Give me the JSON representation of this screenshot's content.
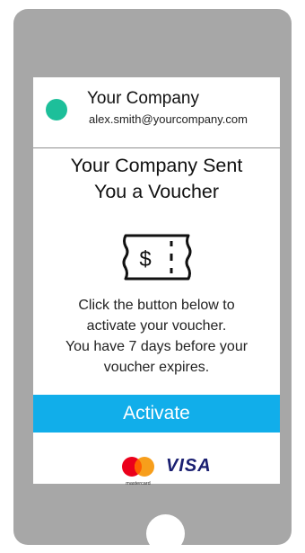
{
  "header": {
    "company_name": "Your Company",
    "email": "alex.smith@yourcompany.com"
  },
  "headline": {
    "line1": "Your Company Sent",
    "line2": "You a Voucher"
  },
  "voucher_icon": {
    "name": "voucher-ticket-icon",
    "symbol": "$"
  },
  "body": {
    "line1": "Click the button below to",
    "line2": "activate your voucher.",
    "line3": "You have 7 days before your",
    "line4": "voucher expires."
  },
  "activate_button": {
    "label": "Activate"
  },
  "payment_logos": {
    "mastercard_caption": "mastercard",
    "visa_label": "VISA"
  },
  "colors": {
    "avatar": "#1dbf9a",
    "button": "#11aeea",
    "phone_frame": "#a7a7a7"
  }
}
